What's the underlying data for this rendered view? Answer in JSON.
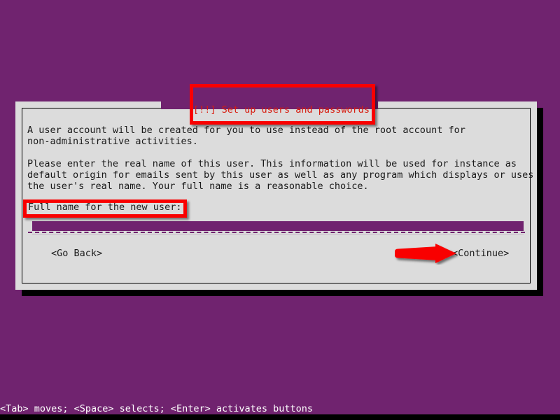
{
  "screen": {
    "background_color": "#70236F",
    "accent_red": "#f90000",
    "dialog_bg": "#dcdcdc",
    "text_color": "#1a1a1a"
  },
  "dialog": {
    "title": "[!!] Set up users and passwords",
    "title_color": "#d81b0e",
    "paragraph_1": "A user account will be created for you to use instead of the root account for\nnon-administrative activities.",
    "paragraph_2": "Please enter the real name of this user. This information will be used for instance as\ndefault origin for emails sent by this user as well as any program which displays or uses\nthe user's real name. Your full name is a reasonable choice.",
    "field_label": "Full name for the new user:",
    "field_value": "",
    "field_placeholder": "",
    "buttons": {
      "go_back": "<Go Back>",
      "continue": "<Continue>"
    }
  },
  "status_bar": {
    "hint": "<Tab> moves; <Space> selects; <Enter> activates buttons"
  },
  "annotations": {
    "title_highlight": "red-rectangle-highlight",
    "field_highlight": "red-rectangle-highlight",
    "continue_pointer": "red-arrow-pointing-right"
  }
}
